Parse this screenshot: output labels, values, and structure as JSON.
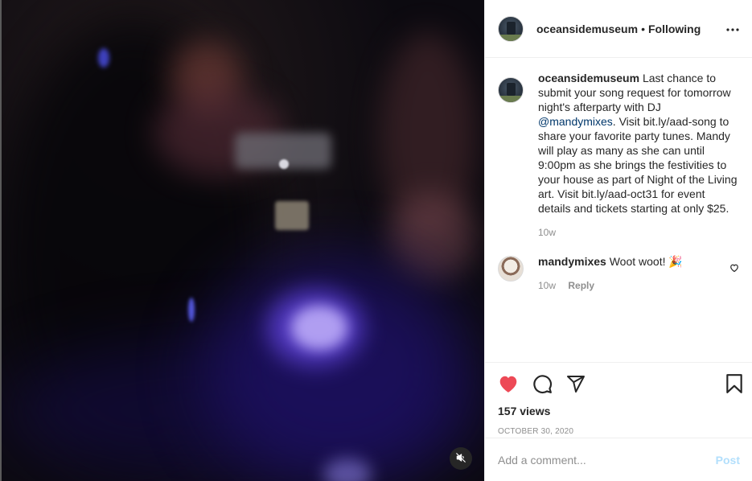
{
  "header": {
    "username": "oceansidemuseum",
    "separator": "•",
    "follow_status": "Following",
    "more_label": "•••"
  },
  "caption": {
    "username": "oceansidemuseum",
    "text_before": "Last chance to submit your song request for tomorrow night's afterparty with DJ ",
    "mention": "@mandymixes",
    "text_after": ". Visit bit.ly/aad-song to share your favorite party tunes. Mandy will play as many as she can until 9:00pm as she brings the festivities to your house as part of Night of the Living art. Visit bit.ly/aad-oct31 for event details and tickets starting at only $25.",
    "time": "10w"
  },
  "comments": [
    {
      "username": "mandymixes",
      "text": "Woot woot! 🎉",
      "time": "10w",
      "reply_label": "Reply"
    }
  ],
  "stats": {
    "views": "157 views",
    "date": "OCTOBER 30, 2020"
  },
  "add_comment": {
    "placeholder": "Add a comment...",
    "post_label": "Post"
  },
  "colors": {
    "like": "#ed4956",
    "mention": "#00376b",
    "post_disabled": "#b2dffc"
  },
  "icons": [
    "volume-off-icon",
    "more-icon",
    "heart-icon",
    "comment-icon",
    "share-icon",
    "bookmark-icon"
  ]
}
